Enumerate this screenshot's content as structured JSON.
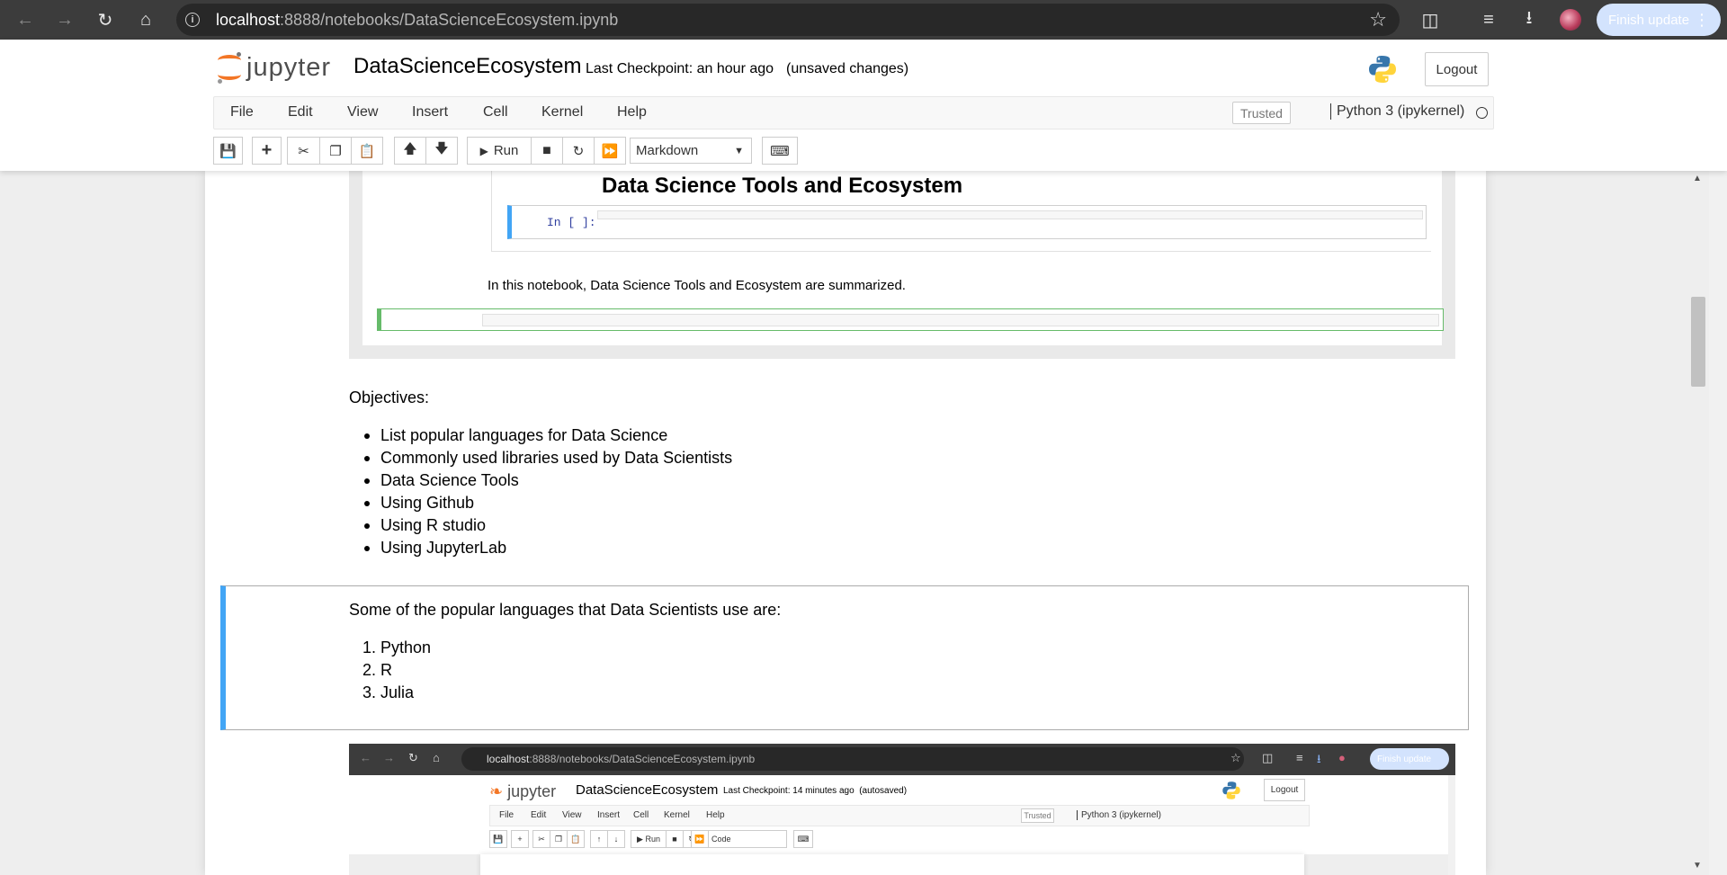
{
  "browser": {
    "back_icon": "arrow-left-icon",
    "forward_icon": "arrow-right-icon",
    "reload_icon": "reload-icon",
    "home_icon": "home-icon",
    "url_host": "localhost",
    "url_rest": ":8888/notebooks/DataScienceEcosystem.ipynb",
    "finish_update_label": "Finish update"
  },
  "header": {
    "logo_text": "jupyter",
    "notebook_title": "DataScienceEcosystem",
    "checkpoint": "Last Checkpoint: an hour ago",
    "save_status": "(unsaved changes)",
    "logout_label": "Logout"
  },
  "menubar": {
    "items": [
      "File",
      "Edit",
      "View",
      "Insert",
      "Cell",
      "Kernel",
      "Help"
    ],
    "trusted_label": "Trusted",
    "kernel_name": "Python 3 (ipykernel)"
  },
  "toolbar": {
    "run_label": "Run",
    "cell_type": "Markdown"
  },
  "notebook": {
    "embedded_image_1": {
      "heading": "Data Science Tools and Ecosystem",
      "prompt": "In [ ]:",
      "markdown_text": "In this notebook, Data Science Tools and Ecosystem are summarized."
    },
    "objectives_heading": "Objectives:",
    "objectives": [
      "List popular languages for Data Science",
      "Commonly used libraries used by Data Scientists",
      "Data Science Tools",
      "Using Github",
      "Using R studio",
      "Using JupyterLab"
    ],
    "languages_intro": "Some of the popular languages that Data Scientists use are:",
    "languages": [
      "1. Python",
      "2. R",
      "3. Julia"
    ],
    "embedded_image_2": {
      "url_host": "localhost",
      "url_rest": ":8888/notebooks/DataScienceEcosystem.ipynb",
      "finish_update_label": "Finish update",
      "logo_text": "jupyter",
      "notebook_title": "DataScienceEcosystem",
      "checkpoint": "Last Checkpoint: 14 minutes ago",
      "save_status": "(autosaved)",
      "logout_label": "Logout",
      "menu_items": [
        "File",
        "Edit",
        "View",
        "Insert",
        "Cell",
        "Kernel",
        "Help"
      ],
      "trusted_label": "Trusted",
      "kernel_name": "Python 3 (ipykernel)",
      "run_label": "Run",
      "cell_type": "Code"
    }
  },
  "colors": {
    "jupyter_orange": "#f37626",
    "selected_cell_blue": "#42a5f5",
    "edit_cell_green": "#66bb6a"
  }
}
